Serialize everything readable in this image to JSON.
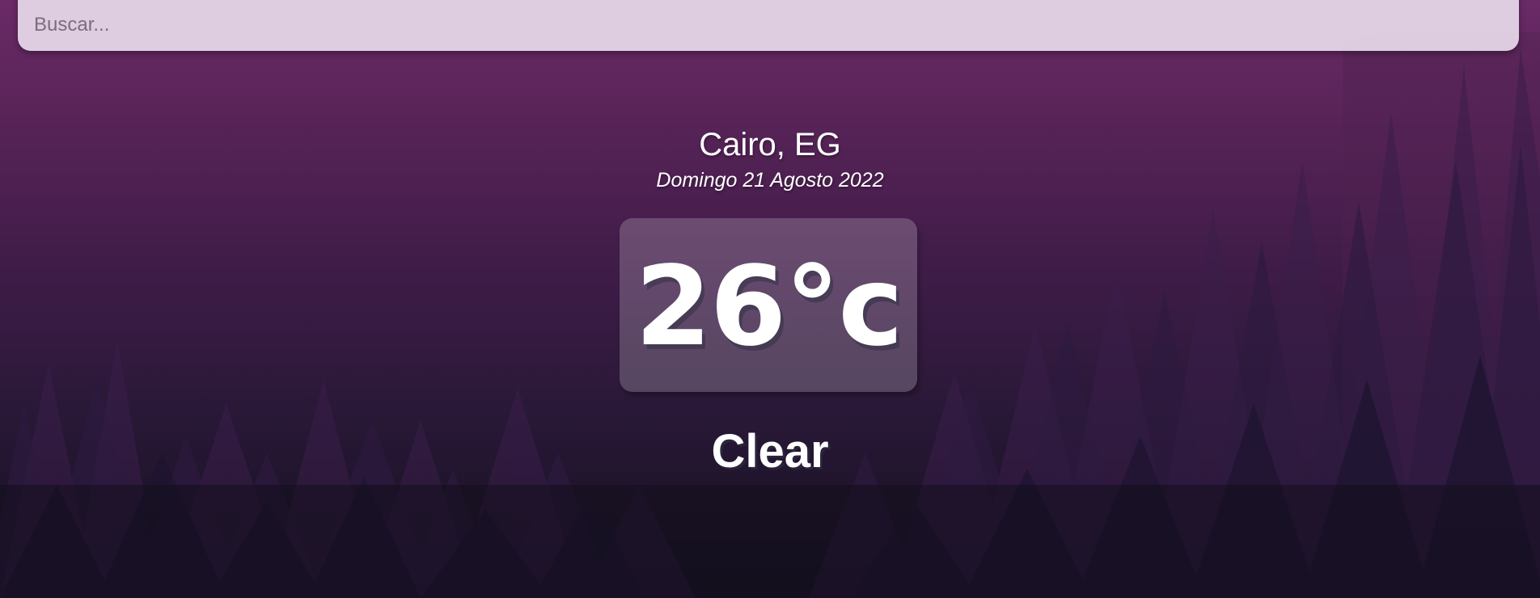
{
  "search": {
    "placeholder": "Buscar..."
  },
  "location": {
    "city": "Cairo, EG",
    "date": "Domingo 21 Agosto 2022"
  },
  "weather": {
    "temperature": "26°c",
    "condition": "Clear"
  },
  "colors": {
    "background_top": "#6a2a66",
    "background_bottom": "#14101f",
    "search_bar": "#e6d7e8",
    "text": "#ffffff"
  }
}
